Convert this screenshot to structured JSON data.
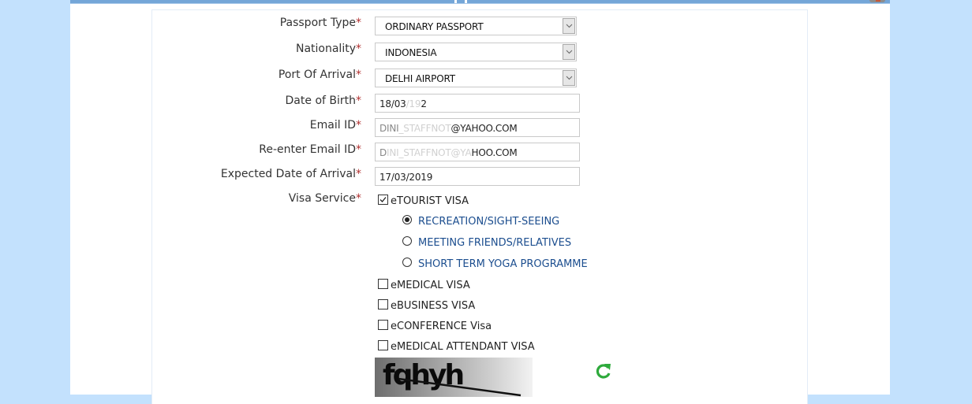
{
  "form": {
    "passport_type": {
      "label": "Passport Type",
      "required": "*",
      "value": "ORDINARY PASSPORT"
    },
    "nationality": {
      "label": "Nationality",
      "required": "*",
      "value": "INDONESIA"
    },
    "port_of_arrival": {
      "label": "Port Of Arrival",
      "required": "*",
      "value": "DELHI AIRPORT"
    },
    "date_of_birth": {
      "label": "Date of Birth",
      "required": "*",
      "value_visible": "18/03",
      "value_masked": "/19",
      "value_tail": "2"
    },
    "email": {
      "label": "Email ID",
      "required": "*",
      "value_visible_start": "DINI",
      "value_masked": "_STAFFNOT",
      "value_visible_end": "@YAHOO.COM"
    },
    "reenter_email": {
      "label": "Re-enter Email ID",
      "required": "*",
      "value_visible_start": "D",
      "value_masked": "INI_STAFFNOT@YA",
      "value_visible_end": "HOO.COM"
    },
    "expected_arrival": {
      "label": "Expected Date of Arrival",
      "required": "*",
      "value": "17/03/2019"
    },
    "visa_service": {
      "label": "Visa Service",
      "required": "*",
      "options": [
        {
          "label": "eTOURIST VISA",
          "checked": true
        },
        {
          "label": "eMEDICAL VISA",
          "checked": false
        },
        {
          "label": "eBUSINESS VISA",
          "checked": false
        },
        {
          "label": "eCONFERENCE Visa",
          "checked": false
        },
        {
          "label": "eMEDICAL ATTENDANT VISA",
          "checked": false
        }
      ],
      "tourist_purposes": [
        {
          "label": "RECREATION/SIGHT-SEEING",
          "selected": true
        },
        {
          "label": "MEETING FRIENDS/RELATIVES",
          "selected": false
        },
        {
          "label": "SHORT TERM YOGA PROGRAMME",
          "selected": false
        }
      ]
    },
    "captcha": {
      "text": "fqhyh"
    }
  },
  "colors": {
    "background": "#c3e1fd",
    "header_bar": "#74a6d8",
    "required_star": "#b03030",
    "sub_option_text": "#1c4e8f",
    "refresh_icon": "#2eaa3c"
  }
}
